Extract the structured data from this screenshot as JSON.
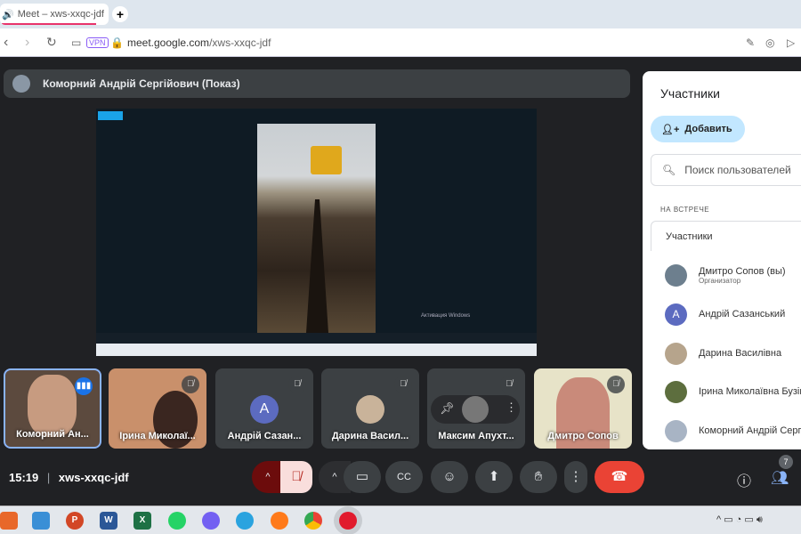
{
  "browser": {
    "tab_title": "Meet – xws-xxqc-jdf",
    "new_tab": "+",
    "vpn": "VPN",
    "url_host": "meet.google.com",
    "url_path": "/xws-xxqc-jdf"
  },
  "presentation": {
    "presenter": "Коморний Андрій Сергійович (Показ)",
    "shared_screen": {
      "watermark": "Активация Windows"
    }
  },
  "tiles": [
    {
      "name": "Коморний Ан...",
      "speaking": true
    },
    {
      "name": "Ірина Миколаї...",
      "muted": true
    },
    {
      "name": "Андрій Сазан...",
      "initial": "А",
      "muted": true
    },
    {
      "name": "Дарина Васил...",
      "muted": true
    },
    {
      "name": "Максим Апухт...",
      "muted": true
    },
    {
      "name": "Дмитро Сопов",
      "muted": true
    }
  ],
  "panel": {
    "title": "Участники",
    "add": "Добавить",
    "search_placeholder": "Поиск пользователей",
    "section": "НА ВСТРЕЧЕ",
    "group": "Участники",
    "people": [
      {
        "name": "Дмитро Сопов (вы)",
        "role": "Организатор"
      },
      {
        "name": "Андрій Сазанський",
        "initial": "А"
      },
      {
        "name": "Дарина Василівна"
      },
      {
        "name": "Ірина Миколаївна Бузін"
      },
      {
        "name": "Коморний Андрій Серг"
      }
    ]
  },
  "footer": {
    "time": "15:19",
    "separator": "|",
    "meeting_code": "xws-xxqc-jdf",
    "participants_count": "7"
  },
  "colors": {
    "accent": "#8ab4f8",
    "end_call": "#ea4335",
    "muted_mic": "#f9dedc"
  }
}
